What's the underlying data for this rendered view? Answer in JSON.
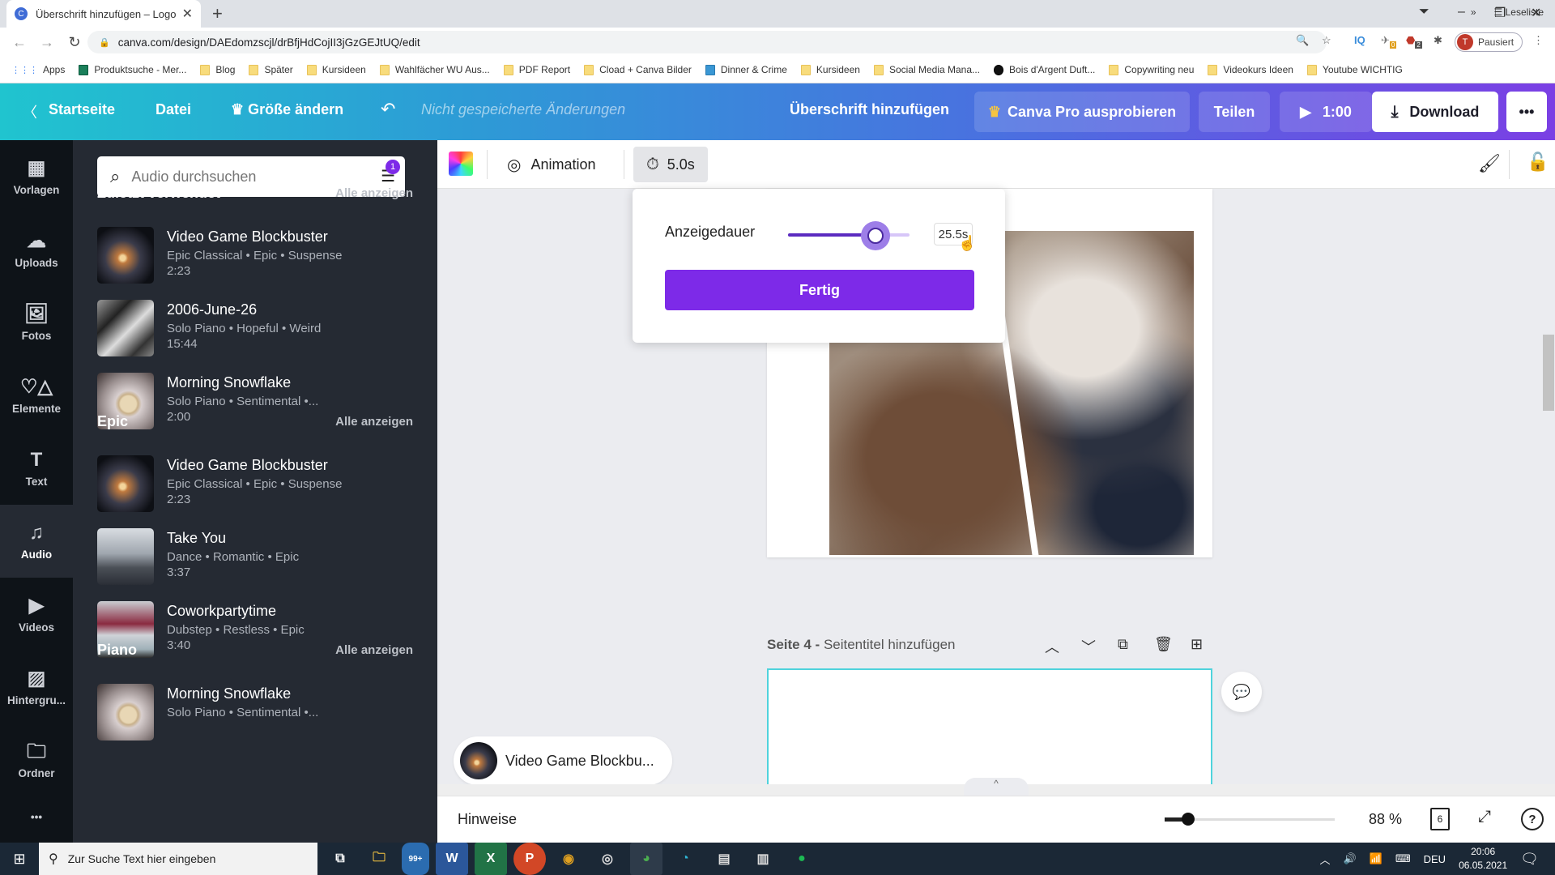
{
  "browser": {
    "tab_title": "Überschrift hinzufügen – Logo",
    "favicon": "C",
    "new_tab_icon": "+",
    "url": "canva.com/design/DAEdomzscjl/drBfjHdCojII3jGzGEJtUQ/edit",
    "profile_initial": "T",
    "profile_status": "Pausiert",
    "ext_badges": {
      "bird": "0",
      "abp": "2"
    },
    "ext_iq": "IQ",
    "bookmarks": [
      {
        "label": "Apps",
        "icon": "apps"
      },
      {
        "label": "Produktsuche - Mer...",
        "icon": "green"
      },
      {
        "label": "Blog",
        "icon": "folder"
      },
      {
        "label": "Später",
        "icon": "folder"
      },
      {
        "label": "Kursideen",
        "icon": "folder"
      },
      {
        "label": "Wahlfächer WU Aus...",
        "icon": "folder"
      },
      {
        "label": "PDF Report",
        "icon": "folder"
      },
      {
        "label": "Cload + Canva Bilder",
        "icon": "folder"
      },
      {
        "label": "Dinner & Crime",
        "icon": "jd"
      },
      {
        "label": "Kursideen",
        "icon": "folder"
      },
      {
        "label": "Social Media Mana...",
        "icon": "folder"
      },
      {
        "label": "Bois d'Argent Duft...",
        "icon": "black"
      },
      {
        "label": "Copywriting neu",
        "icon": "folder"
      },
      {
        "label": "Videokurs Ideen",
        "icon": "folder"
      },
      {
        "label": "Youtube WICHTIG",
        "icon": "folder"
      }
    ],
    "bookmarks_more": "»",
    "reading_list": "Leseliste"
  },
  "header": {
    "home": "Startseite",
    "file": "Datei",
    "resize": "Größe ändern",
    "unsaved": "Nicht gespeicherte Änderungen",
    "design_title": "Überschrift hinzufügen",
    "try_pro": "Canva Pro ausprobieren",
    "share": "Teilen",
    "play_duration": "1:00",
    "download": "Download",
    "more": "•••"
  },
  "rail": [
    {
      "label": "Vorlagen",
      "icon": "▦"
    },
    {
      "label": "Uploads",
      "icon": "☁"
    },
    {
      "label": "Fotos",
      "icon": "🖼"
    },
    {
      "label": "Elemente",
      "icon": "♡△"
    },
    {
      "label": "Text",
      "icon": "T"
    },
    {
      "label": "Audio",
      "icon": "♫"
    },
    {
      "label": "Videos",
      "icon": "▶"
    },
    {
      "label": "Hintergru...",
      "icon": "▨"
    },
    {
      "label": "Ordner",
      "icon": "🗀"
    },
    {
      "label": "•••",
      "icon": ""
    }
  ],
  "panel": {
    "search_placeholder": "Audio durchsuchen",
    "filter_badge": "1",
    "sections": [
      {
        "title": "Zuletzt verwendet",
        "see_all": "Alle anzeigen",
        "tracks": [
          {
            "name": "Video Game Blockbuster",
            "genres": "Epic Classical • Epic • Suspense",
            "duration": "2:23"
          },
          {
            "name": "2006-June-26",
            "genres": "Solo Piano • Hopeful • Weird",
            "duration": "15:44"
          },
          {
            "name": "Morning Snowflake",
            "genres": "Solo Piano • Sentimental •...",
            "duration": "2:00"
          }
        ]
      },
      {
        "title": "Epic",
        "see_all": "Alle anzeigen",
        "tracks": [
          {
            "name": "Video Game Blockbuster",
            "genres": "Epic Classical • Epic • Suspense",
            "duration": "2:23"
          },
          {
            "name": "Take You",
            "genres": "Dance • Romantic • Epic",
            "duration": "3:37"
          },
          {
            "name": "Coworkpartytime",
            "genres": "Dubstep • Restless • Epic",
            "duration": "3:40"
          }
        ]
      },
      {
        "title": "Piano",
        "see_all": "Alle anzeigen",
        "tracks": [
          {
            "name": "Morning Snowflake",
            "genres": "Solo Piano • Sentimental •...",
            "duration": ""
          }
        ]
      }
    ]
  },
  "toolbar": {
    "animation": "Animation",
    "duration": "5.0s"
  },
  "popover": {
    "label": "Anzeigedauer",
    "value": "25.5s",
    "slider_fraction": 0.72,
    "done": "Fertig"
  },
  "page": {
    "number_label": "Seite 4 -",
    "title_placeholder": "Seitentitel hinzufügen"
  },
  "audio_pill": {
    "name": "Video Game Blockbu..."
  },
  "footer": {
    "notes": "Hinweise",
    "zoom": "88 %",
    "zoom_fraction": 0.14,
    "pages": "6",
    "help": "?"
  },
  "taskbar": {
    "search_placeholder": "Zur Suche Text hier eingeben",
    "mail_badge": "99+",
    "lang": "DEU",
    "time": "20:06",
    "date": "06.05.2021"
  },
  "colors": {
    "accent": "#7d2ae8",
    "selection": "#4fd3dc",
    "panel": "#252a33",
    "rail": "#0e1318"
  }
}
